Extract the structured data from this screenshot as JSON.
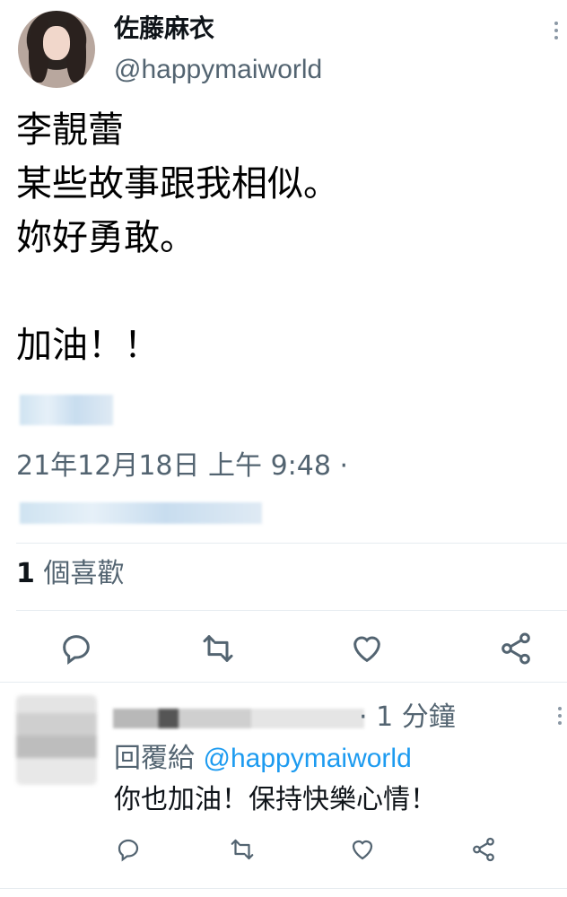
{
  "tweet": {
    "author_name": "佐藤麻衣",
    "handle": "@happymaiworld",
    "avatar_icon": "profile-photo",
    "text_lines": [
      "李靚蕾",
      "某些故事跟我相似。",
      "妳好勇敢。",
      "",
      "加油！！"
    ],
    "timestamp": "21年12月18日 上午 9:48 ·",
    "likes_count": "1",
    "likes_label": " 個喜歡"
  },
  "actions": {
    "reply_icon": "reply-icon",
    "retweet_icon": "retweet-icon",
    "like_icon": "heart-icon",
    "share_icon": "share-icon"
  },
  "reply": {
    "time": "· 1 分鐘",
    "reply_to_label": "回覆給 ",
    "reply_to_handle": "@happymaiworld",
    "text": "你也加油！保持快樂心情！"
  },
  "colors": {
    "secondary_text": "#536471",
    "mention": "#1d9bf0",
    "divider": "#e6ecf0"
  }
}
